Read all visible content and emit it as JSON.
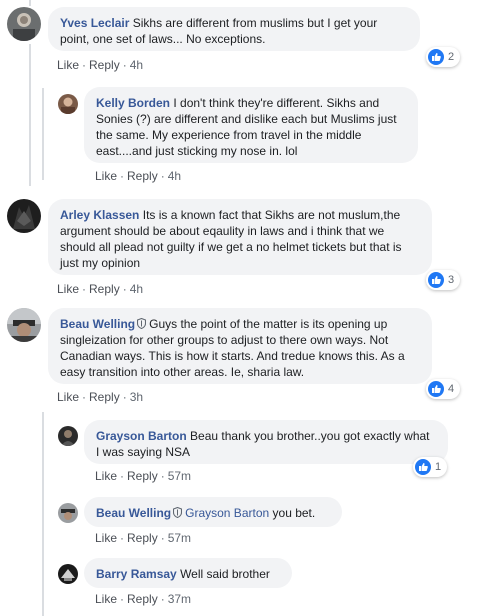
{
  "actions": {
    "like": "Like",
    "reply": "Reply"
  },
  "comments": [
    {
      "author": "Yves Leclair",
      "text": "Sikhs are different from muslims but I get your point, one set of laws... No exceptions.",
      "time": "4h",
      "reactions": "2",
      "replies": [
        {
          "author": "Kelly Borden",
          "text": "I don't think they're different. Sikhs and Sonies (?) are different and dislike each but Muslims just the same. My experience from travel in the middle east....and just sticking my nose in. lol",
          "time": "4h"
        }
      ]
    },
    {
      "author": "Arley Klassen",
      "text": "Its is a known fact that Sikhs are not muslum,the argument should be about eqaulity in laws and i think that we should all plead not guilty if we get a no helmet tickets but that is just my opinion",
      "time": "4h",
      "reactions": "3"
    },
    {
      "author": "Beau Welling",
      "text": "Guys the point of the matter is its opening up singleization for other groups to adjust to there own ways. Not Canadian ways. This is how it starts. And tredue knows this. As a easy transition into other areas. Ie, sharia law.",
      "time": "3h",
      "reactions": "4",
      "replies": [
        {
          "author": "Grayson Barton",
          "text": "Beau thank you brother..you got exactly what I was saying NSA",
          "time": "57m",
          "reactions": "1"
        },
        {
          "author": "Beau Welling",
          "mention": "Grayson Barton",
          "text": "you bet.",
          "time": "57m"
        },
        {
          "author": "Barry Ramsay",
          "text": "Well said brother",
          "time": "37m"
        }
      ]
    }
  ]
}
